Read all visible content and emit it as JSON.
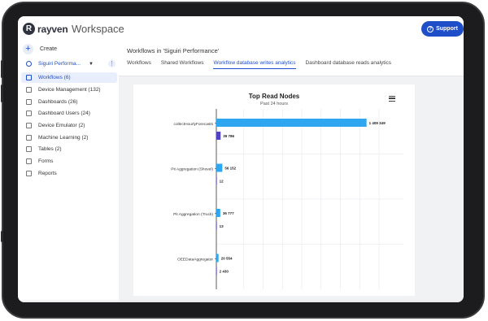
{
  "header": {
    "logo_badge": "R",
    "logo_text": "rayven",
    "workspace_label": "Workspace",
    "support_label": "Support",
    "support_icon": "question-icon"
  },
  "sidebar": {
    "create_label": "Create",
    "project_label": "Siguiri Performa...",
    "items": [
      {
        "label": "Workflows (6)",
        "icon": "workflow-icon"
      },
      {
        "label": "Device Management (132)",
        "icon": "device-icon"
      },
      {
        "label": "Dashboards (26)",
        "icon": "dashboard-icon"
      },
      {
        "label": "Dashboard Users (24)",
        "icon": "users-icon"
      },
      {
        "label": "Device Emulator (2)",
        "icon": "emulator-icon"
      },
      {
        "label": "Machine Learning (2)",
        "icon": "ml-icon"
      },
      {
        "label": "Tables (2)",
        "icon": "table-icon"
      },
      {
        "label": "Forms",
        "icon": "forms-icon"
      },
      {
        "label": "Reports",
        "icon": "reports-icon"
      }
    ]
  },
  "main": {
    "title": "Workflows in 'Siguiri Performance'",
    "tabs": [
      {
        "label": "Workflows"
      },
      {
        "label": "Shared Workflows"
      },
      {
        "label": "Workflow database writes analytics"
      },
      {
        "label": "Dashboard database reads analytics"
      }
    ]
  },
  "colors": {
    "accent": "#1f4fc8",
    "bar_primary": "#2ea7f0",
    "bar_secondary": "#5243c2"
  },
  "chart_data": {
    "type": "bar",
    "orientation": "horizontal",
    "title": "Top Read Nodes",
    "subtitle": "Past 24 hours",
    "categories": [
      "collectHourlyForecasts",
      "Pit Aggregation (Shovel)",
      "Pit Aggregation (Truck)",
      "OEEDataAggregator"
    ],
    "series": [
      {
        "values": [
          1409349,
          56152,
          36777,
          20554
        ],
        "labels": [
          "1 409 349",
          "56 152",
          "36 777",
          "20 554"
        ],
        "color": "#2ea7f0"
      },
      {
        "values": [
          39786,
          12,
          13,
          2430
        ],
        "labels": [
          "39 786",
          "12",
          "13",
          "2 430"
        ],
        "color": "#5243c2"
      }
    ],
    "xlim": [
      0,
      1450000
    ],
    "grid": true
  }
}
